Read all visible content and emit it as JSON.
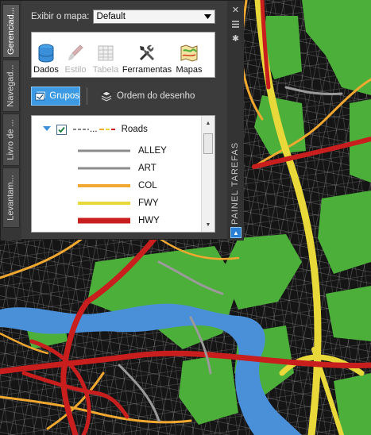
{
  "palette": {
    "side_tabs": [
      "Gerenciad...",
      "Navegad...",
      "Livro de ...",
      "Levantam..."
    ],
    "mapview_label": "Exibir o mapa:",
    "mapview_value": "Default",
    "toolbar": {
      "dados": "Dados",
      "estilo": "Estilo",
      "tabela": "Tabela",
      "ferramentas": "Ferramentas",
      "mapas": "Mapas"
    },
    "tabs": {
      "grupos": "Grupos",
      "ordem": "Ordem do desenho"
    },
    "layer": {
      "name": "Roads",
      "style_preview": "...",
      "checked": true
    },
    "legend": [
      {
        "label": "ALLEY",
        "color": "#8c8c8c"
      },
      {
        "label": "ART",
        "color": "#8c8c8c"
      },
      {
        "label": "COL",
        "color": "#f0a830"
      },
      {
        "label": "FWY",
        "color": "#e8d83a"
      },
      {
        "label": "HWY",
        "color": "#c81e1e"
      }
    ],
    "task_pane_label": "PAINEL TAREFAS"
  },
  "colors": {
    "map_green": "#4caf3a",
    "water": "#4a90d8",
    "road_gray": "#9a9a9a",
    "selected_tab": "#3b9ae3"
  }
}
